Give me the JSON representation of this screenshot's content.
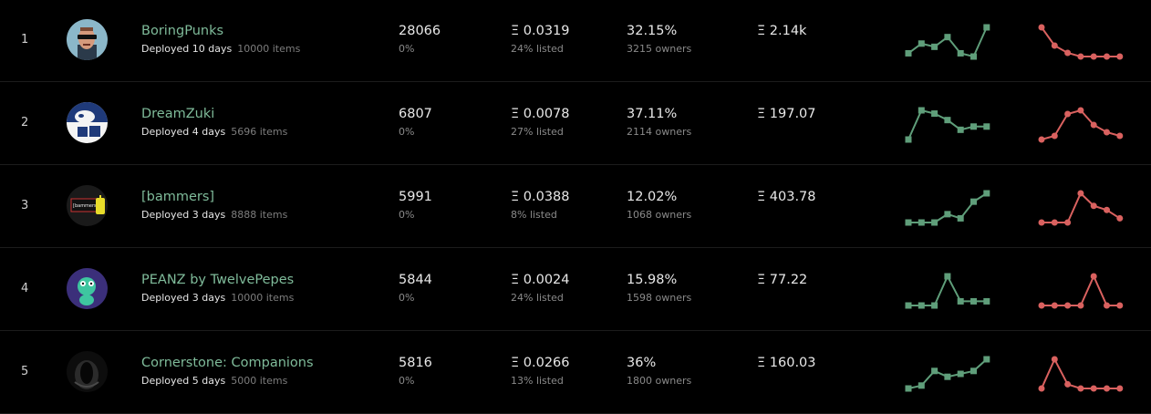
{
  "colors": {
    "accent_green": "#5f9e7a",
    "name_green": "#7fbb9a",
    "spark_red": "#d9615f"
  },
  "rows": [
    {
      "rank": "1",
      "name": "BoringPunks",
      "deployed": "Deployed 10 days",
      "items": "10000 items",
      "sales": "28066",
      "sales_change": "0%",
      "floor": "Ξ 0.0319",
      "listed": "24% listed",
      "owners_pct": "32.15%",
      "owners": "3215 owners",
      "volume": "Ξ 2.14k",
      "trend_green": [
        3,
        6,
        5,
        8,
        3,
        2,
        11
      ],
      "trend_red": [
        10,
        5,
        3,
        2,
        2,
        2,
        2
      ],
      "avatar_icon": "punk-avatar-icon"
    },
    {
      "rank": "2",
      "name": "DreamZuki",
      "deployed": "Deployed 4 days",
      "items": "5696 items",
      "sales": "6807",
      "sales_change": "0%",
      "floor": "Ξ 0.0078",
      "listed": "27% listed",
      "owners_pct": "37.11%",
      "owners": "2114 owners",
      "volume": "Ξ 197.07",
      "trend_green": [
        1,
        10,
        9,
        7,
        4,
        5,
        5
      ],
      "trend_red": [
        1,
        2,
        8,
        9,
        5,
        3,
        2
      ],
      "avatar_icon": "dreamzuki-avatar-icon"
    },
    {
      "rank": "3",
      "name": "[bammers]",
      "deployed": "Deployed 3 days",
      "items": "8888 items",
      "sales": "5991",
      "sales_change": "0%",
      "floor": "Ξ 0.0388",
      "listed": "8% listed",
      "owners_pct": "12.02%",
      "owners": "1068 owners",
      "volume": "Ξ 403.78",
      "trend_green": [
        1,
        1,
        1,
        3,
        2,
        6,
        8
      ],
      "trend_red": [
        1,
        1,
        1,
        8,
        5,
        4,
        2
      ],
      "avatar_icon": "bammers-avatar-icon",
      "avatar_text": "[bammers]"
    },
    {
      "rank": "4",
      "name": "PEANZ by TwelvePepes",
      "deployed": "Deployed 3 days",
      "items": "10000 items",
      "sales": "5844",
      "sales_change": "0%",
      "floor": "Ξ 0.0024",
      "listed": "24% listed",
      "owners_pct": "15.98%",
      "owners": "1598 owners",
      "volume": "Ξ 77.22",
      "trend_green": [
        1,
        1,
        1,
        8,
        2,
        2,
        2
      ],
      "trend_red": [
        1,
        1,
        1,
        1,
        8,
        1,
        1
      ],
      "avatar_icon": "pepe-avatar-icon"
    },
    {
      "rank": "5",
      "name": "Cornerstone: Companions",
      "deployed": "Deployed 5 days",
      "items": "5000 items",
      "sales": "5816",
      "sales_change": "0%",
      "floor": "Ξ 0.0266",
      "listed": "13% listed",
      "owners_pct": "36%",
      "owners": "1800 owners",
      "volume": "Ξ 160.03",
      "trend_green": [
        0,
        1,
        6,
        4,
        5,
        6,
        10
      ],
      "trend_red": [
        1,
        8,
        2,
        1,
        1,
        1,
        1
      ],
      "avatar_icon": "alien-helmet-avatar-icon"
    }
  ]
}
